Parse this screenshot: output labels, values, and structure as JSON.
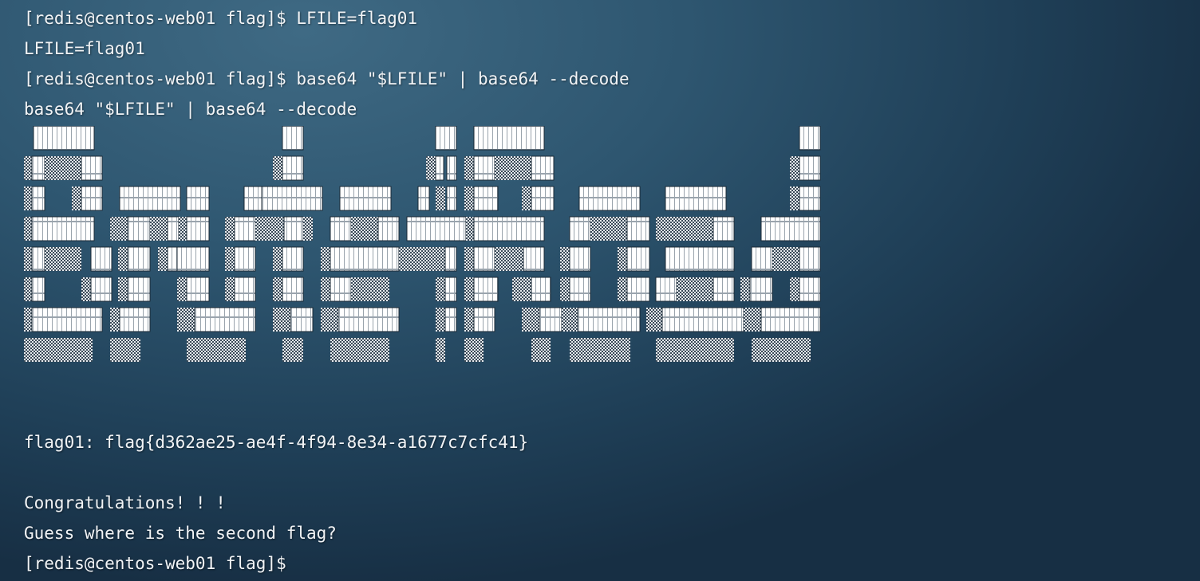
{
  "terminal": {
    "lines": {
      "l1": "[redis@centos-web01 flag]$ LFILE=flag01",
      "l2": "LFILE=flag01",
      "l3": "[redis@centos-web01 flag]$ base64 \"$LFILE\" | base64 --decode",
      "l4": "base64 \"$LFILE\" | base64 --decode",
      "l5": "flag01: flag{d362ae25-ae4f-4f94-8e34-a1677c7cfc41}",
      "l6": "Congratulations! ! !",
      "l7": "Guess where is the second flag?",
      "l8": "[redis@centos-web01 flag]$"
    }
  },
  "colors": {
    "text": "#f2f4f6",
    "background": "#2e5670"
  }
}
